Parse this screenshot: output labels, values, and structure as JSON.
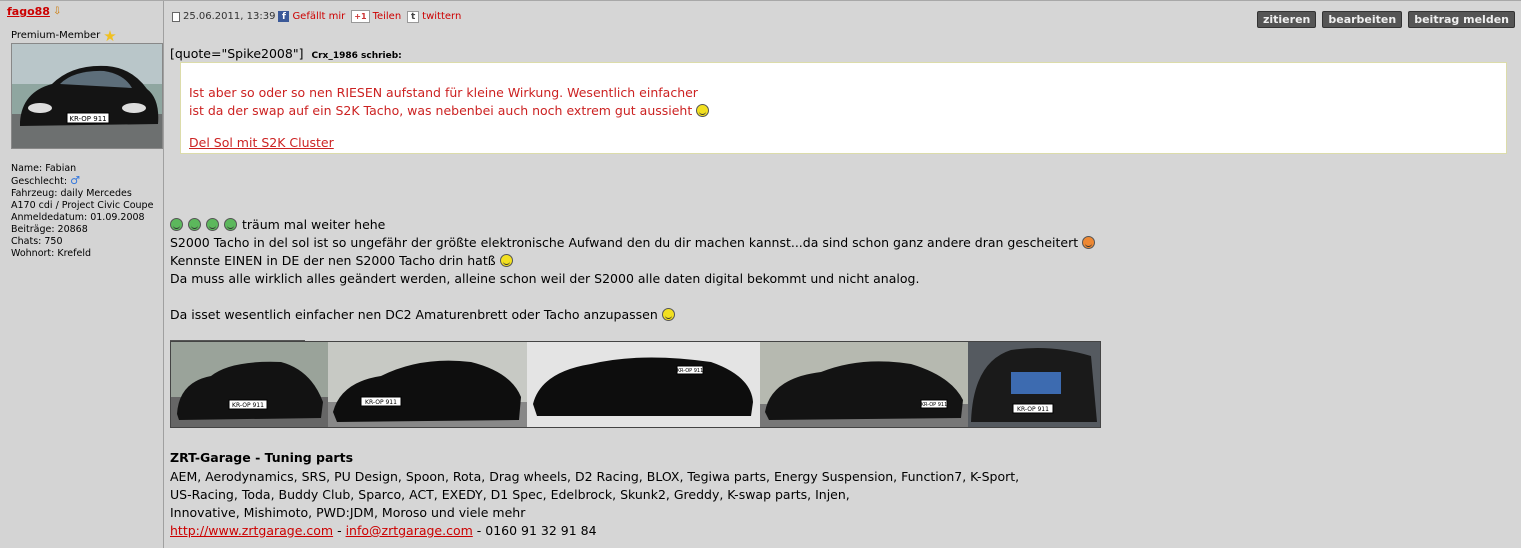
{
  "user": {
    "name": "fago88",
    "rank": "Premium-Member",
    "avatar_plate": "KR-OP 911",
    "info": [
      "Name: Fabian",
      "Geschlecht:",
      "Fahrzeug: daily Mercedes A170 cdi / Project Civic Coupe",
      "Anmeldedatum: 01.09.2008",
      "Beiträge: 20868",
      "Chats: 750",
      "Wohnort: Krefeld"
    ]
  },
  "post": {
    "datetime": "25.06.2011, 13:39",
    "like": "Gefällt mir",
    "share_icon": "+1",
    "share": "Teilen",
    "tweet": "twittern",
    "actions": {
      "quote": "zitieren",
      "edit": "bearbeiten",
      "report": "beitrag melden"
    },
    "quote_raw": "[quote=\"Spike2008\"]",
    "quote_author": "Crx_1986 schrieb:",
    "quote_line1": "Ist aber so oder so nen RIESEN aufstand für kleine Wirkung. Wesentlich einfacher",
    "quote_line2": "ist da der swap auf ein S2K Tacho, was nebenbei auch noch extrem gut aussieht",
    "quote_link": "Del Sol mit S2K Cluster",
    "line1": "träum mal weiter hehe",
    "line2": "S2000 Tacho in del sol ist so ungefähr der größte elektronische Aufwand den du dir machen kannst...da sind schon ganz andere dran gescheitert",
    "line3": "Kennste EINEN in DE der nen S2000 Tacho drin hatß",
    "line4": "Da muss alle wirklich alles geändert werden, alleine schon weil der S2000 alle daten digital bekommt und nicht analog.",
    "line5": "Da isset wesentlich einfacher nen DC2 Amaturenbrett oder Tacho anzupassen"
  },
  "signature": {
    "banner_plates": [
      "KR-OP 911",
      "KR-OP 911",
      "KR-OP 911",
      "KR-OP 911",
      "KR-OP 911"
    ],
    "title": "ZRT-Garage - Tuning parts",
    "line1": "AEM, Aerodynamics, SRS, PU Design, Spoon, Rota, Drag wheels, D2 Racing, BLOX, Tegiwa parts, Energy Suspension, Function7, K-Sport,",
    "line2": "US-Racing, Toda, Buddy Club, Sparco, ACT, EXEDY, D1 Spec, Edelbrock, Skunk2, Greddy, K-swap parts, Injen,",
    "line3": "Innovative, Mishimoto, PWD:JDM, Moroso und viele mehr",
    "url": "http://www.zrtgarage.com",
    "sep": " - ",
    "email": "info@zrtgarage.com",
    "phone": " - 0160 91 32 91 84"
  },
  "colors": {
    "link": "#cc0000",
    "quote_text": "#cc2222",
    "button_bg": "#555555",
    "page_bg": "#d4d4d4"
  },
  "icons": [
    "online-arrow-icon",
    "premium-star-icon",
    "male-icon",
    "document-icon",
    "facebook-icon",
    "google-plus-icon",
    "twitter-icon",
    "smiley-icon",
    "grin-icon",
    "angry-icon"
  ]
}
